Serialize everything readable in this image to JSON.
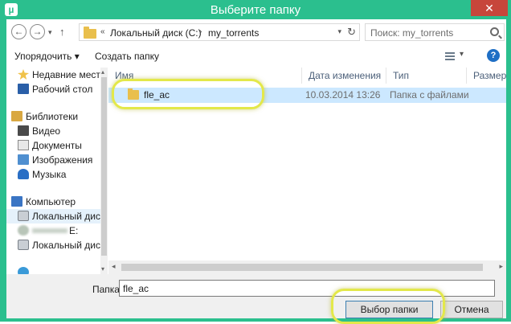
{
  "window": {
    "title": "Выберите папку",
    "close_glyph": "✕",
    "app_icon_glyph": "µ"
  },
  "address": {
    "breadcrumb_prefix": "«",
    "crumbs": [
      "Локальный диск (C:)",
      "my_torrents"
    ],
    "separator": "›",
    "search_placeholder": "Поиск: my_torrents"
  },
  "toolbar": {
    "organize": "Упорядочить ▾",
    "new_folder": "Создать папку",
    "view_dropdown": "▾",
    "help": "?"
  },
  "navpane": {
    "items": [
      {
        "label": "Недавние места",
        "icon": "recent-places-icon"
      },
      {
        "label": "Рабочий стол",
        "icon": "desktop-icon"
      },
      {
        "label": "Библиотеки",
        "icon": "libraries-icon"
      },
      {
        "label": "Видео",
        "icon": "videos-icon"
      },
      {
        "label": "Документы",
        "icon": "documents-icon"
      },
      {
        "label": "Изображения",
        "icon": "pictures-icon"
      },
      {
        "label": "Музыка",
        "icon": "music-icon"
      },
      {
        "label": "Компьютер",
        "icon": "computer-icon"
      },
      {
        "label": "Локальный диск",
        "icon": "drive-icon"
      },
      {
        "label": "E:",
        "icon": "blurred-drive-icon"
      },
      {
        "label": "Локальный диск",
        "icon": "drive-icon"
      }
    ]
  },
  "filelist": {
    "columns": [
      "Имя",
      "Дата изменения",
      "Тип",
      "Размер"
    ],
    "rows": [
      {
        "name": "fle_ac",
        "date": "10.03.2014 13:26",
        "type": "Папка с файлами",
        "size": ""
      }
    ]
  },
  "bottom": {
    "folder_label": "Папка:",
    "folder_value": "fle_ac",
    "select_button": "Выбор папки",
    "cancel_button": "Отмена"
  },
  "colors": {
    "titlebar": "#2bbf8e",
    "selection": "#cce8ff",
    "highlight_ring": "#e3e84a",
    "close_button": "#c7463b"
  }
}
